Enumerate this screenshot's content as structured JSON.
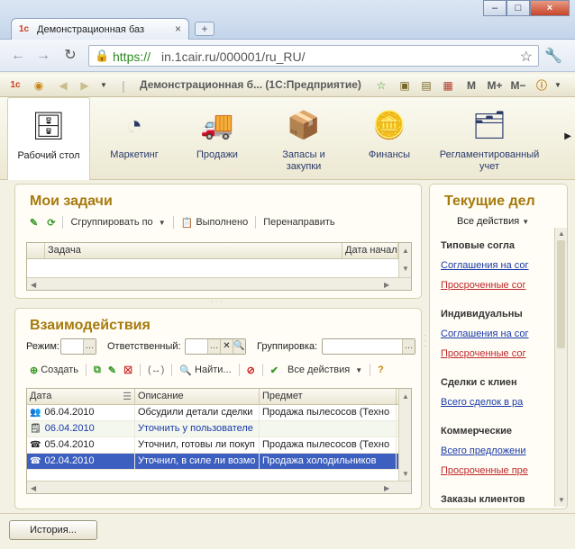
{
  "browser": {
    "tab_title": "Демонстрационная баз",
    "url_scheme": "https://",
    "url_rest": "in.1cair.ru/000001/ru_RU/"
  },
  "app_toolbar": {
    "title": "Демонстрационная б... (1С:Предприятие)",
    "m_label": "M",
    "m_plus_label": "M+",
    "m_minus_label": "M−"
  },
  "sections": [
    {
      "label": "Рабочий стол",
      "icon": "desk-icon",
      "active": true
    },
    {
      "label": "Маркетинг",
      "icon": "pie-chart-icon"
    },
    {
      "label": "Продажи",
      "icon": "truck-icon"
    },
    {
      "label": "Запасы и закупки",
      "icon": "boxes-icon"
    },
    {
      "label": "Финансы",
      "icon": "coins-icon"
    },
    {
      "label": "Регламентированный учет",
      "icon": "documents-icon"
    }
  ],
  "tasks": {
    "title": "Мои задачи",
    "group_by_label": "Сгруппировать по",
    "done_label": "Выполнено",
    "redirect_label": "Перенаправить",
    "columns": [
      "Задача",
      "Дата начал"
    ]
  },
  "interactions": {
    "title": "Взаимодействия",
    "filter_mode_label": "Режим:",
    "filter_responsible_label": "Ответственный:",
    "filter_grouping_label": "Группировка:",
    "create_label": "Создать",
    "find_label": "Найти...",
    "all_actions_label": "Все действия",
    "columns": [
      "Дата",
      "Описание",
      "Предмет"
    ],
    "rows": [
      {
        "date": "06.04.2010",
        "description": "Обсудили детали сделки",
        "subject": "Продажа пылесосов (Техно",
        "icon": "meeting-icon",
        "style": "normal"
      },
      {
        "date": "06.04.2010",
        "description": "Уточнить у пользователе",
        "subject": "",
        "icon": "task-icon",
        "style": "link"
      },
      {
        "date": "05.04.2010",
        "description": "Уточнил, готовы ли покуп",
        "subject": "Продажа пылесосов (Техно",
        "icon": "phone-icon",
        "style": "normal"
      },
      {
        "date": "02.04.2010",
        "description": "Уточнил, в силе ли возмо",
        "subject": "Продажа холодильников",
        "icon": "phone-icon",
        "style": "selected"
      }
    ]
  },
  "current_affairs": {
    "title": "Текущие дел",
    "all_actions_label": "Все действия",
    "groups": [
      {
        "title": "Типовые согла",
        "links": [
          {
            "text": "Соглашения на сог",
            "color": "blue"
          },
          {
            "text": "Просроченные сог",
            "color": "red"
          }
        ]
      },
      {
        "title": "Индивидуальны",
        "links": [
          {
            "text": "Соглашения на сог",
            "color": "blue"
          },
          {
            "text": "Просроченные сог",
            "color": "red"
          }
        ]
      },
      {
        "title": "Сделки с клиен",
        "links": [
          {
            "text": "Всего сделок в ра",
            "color": "blue"
          }
        ]
      },
      {
        "title": "Коммерческие",
        "links": [
          {
            "text": "Всего предложени",
            "color": "blue"
          },
          {
            "text": "Просроченные пре",
            "color": "red"
          }
        ]
      },
      {
        "title": "Заказы клиентов",
        "links": []
      }
    ]
  },
  "statusbar": {
    "history_label": "История..."
  }
}
